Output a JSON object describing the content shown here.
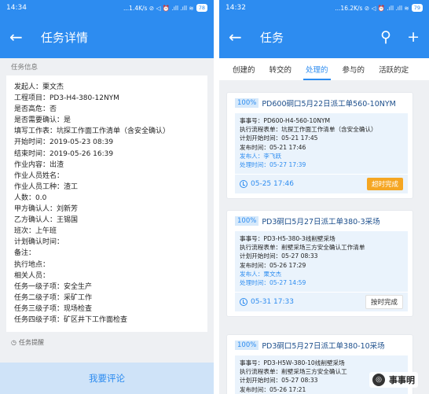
{
  "left": {
    "status": {
      "time": "14:34",
      "network": "...1.4K/s ⊘ ◁ ⏰ .ıll .ıll ≋",
      "battery": "78"
    },
    "header": {
      "title": "任务详情"
    },
    "section_title": "任务信息",
    "info_lines": [
      "发起人：栗文杰",
      "工程项目：PD3-H4-380-12NYM",
      "是否高危：否",
      "是否需要确认：是",
      "填写工作表：坑探工作面工作清单（含安全确认）",
      "开始时间：2019-05-23 08:39",
      "结束时间：2019-05-26 16:39",
      "作业内容：出渣",
      "作业人员姓名：",
      "作业人员工种：渣工",
      "人数：0.0",
      "甲方确认人：刘新芳",
      "乙方确认人：王锡国",
      "班次：上午班",
      "计划确认时间：",
      "备注：",
      "执行地点：",
      "相关人员：",
      "任务一级子项：安全生产",
      "任务二级子项：采矿工作",
      "任务三级子项：现场检查",
      "任务四级子项：矿区井下工作面检查"
    ],
    "reminder_label": "任务提醒",
    "comment_button": "我要评论"
  },
  "right": {
    "status": {
      "time": "14:32",
      "network": "...16.2K/s ⊘ ◁ ⏰ .ıll .ıll ≋",
      "battery": "79"
    },
    "header": {
      "title": "任务"
    },
    "tabs": [
      "创建的",
      "转交的",
      "处理的",
      "参与的",
      "活跃的定"
    ],
    "tasks": [
      {
        "percent": "100%",
        "title": "PD600硐口5月22日派工单560-10NYM",
        "lines": [
          "事事号：PD600-H4-560-10NYM",
          "执行流程表单：坑探工作面工作清单（含安全确认）",
          "计划开始时间：05-21 17:45",
          "发布时间：05-21 17:46"
        ],
        "publisher": "发布人：李飞跃",
        "handled": "处理时间：05-27 17:39",
        "due": "05-25 17:46",
        "status": "超时完成"
      },
      {
        "percent": "100%",
        "title": "PD3硐口5月27日派工单380-3采场",
        "lines": [
          "事事号：PD3-H5-380-3线削壁采场",
          "执行流程表单：削壁采场三方安全确认工作清单",
          "计划开始时间：05-27 08:33",
          "发布时间：05-26 17:29"
        ],
        "publisher": "发布人：栗文杰",
        "handled": "处理时间：05-27 14:59",
        "due": "05-31 17:33",
        "status": "按时完成"
      },
      {
        "percent": "100%",
        "title": "PD3硐口5月27日派工单380-10采场",
        "lines": [
          "事事号：PD3-H5W-380-10线削壁采场",
          "执行流程表单：削壁采场三方安全确认工",
          "计划开始时间：05-27 08:33",
          "发布时间：05-26 17:21"
        ]
      }
    ],
    "watermark": "事事明"
  }
}
